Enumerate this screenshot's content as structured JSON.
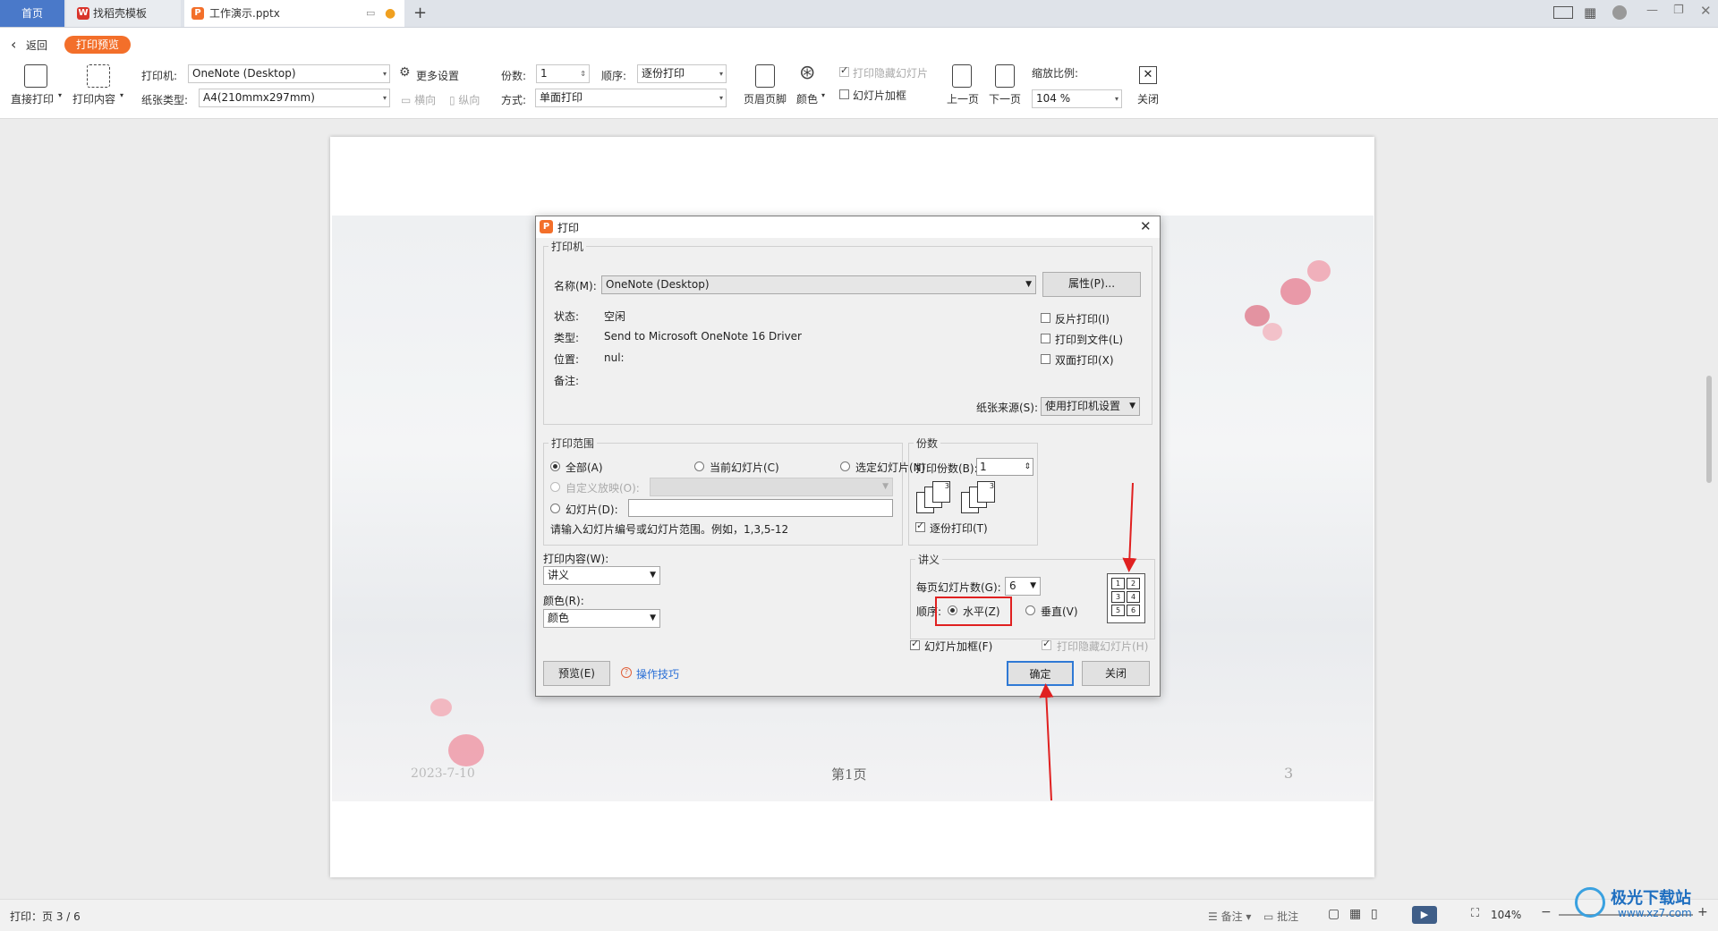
{
  "tabs": {
    "home": "首页",
    "template": "找稻壳模板",
    "file": "工作演示.pptx",
    "add": "+"
  },
  "toolbar": {
    "back": "返回",
    "badge": "打印预览",
    "direct_print": "直接打印",
    "print_content": "打印内容",
    "printer_label": "打印机:",
    "printer_value": "OneNote (Desktop)",
    "more_settings": "更多设置",
    "paper_label": "纸张类型:",
    "paper_value": "A4(210mmx297mm)",
    "landscape": "横向",
    "portrait": "纵向",
    "copies_label": "份数:",
    "copies_value": "1",
    "order_label": "顺序:",
    "order_value": "逐份打印",
    "mode_label": "方式:",
    "mode_value": "单面打印",
    "header_footer": "页眉页脚",
    "color": "颜色",
    "print_hidden": "打印隐藏幻灯片",
    "slide_frame": "幻灯片加框",
    "prev_page": "上一页",
    "next_page": "下一页",
    "zoom_label": "缩放比例:",
    "zoom_value": "104 %",
    "close": "关闭"
  },
  "slide": {
    "date": "2023-7-10",
    "page": "第1页",
    "number": "3"
  },
  "dialog": {
    "title": "打印",
    "printer_group": "打印机",
    "name_label": "名称(M):",
    "name_value": "OneNote (Desktop)",
    "properties_btn": "属性(P)...",
    "status_label": "状态:",
    "status_value": "空闲",
    "type_label": "类型:",
    "type_value": "Send to Microsoft OneNote 16 Driver",
    "location_label": "位置:",
    "location_value": "nul:",
    "comment_label": "备注:",
    "reverse_print": "反片打印(I)",
    "print_to_file": "打印到文件(L)",
    "duplex": "双面打印(X)",
    "paper_source_label": "纸张来源(S):",
    "paper_source_value": "使用打印机设置",
    "range_group": "打印范围",
    "all": "全部(A)",
    "current_slide": "当前幻灯片(C)",
    "selected_slide": "选定幻灯片(N)",
    "custom_show": "自定义放映(O):",
    "slides": "幻灯片(D):",
    "range_hint": "请输入幻灯片编号或幻灯片范围。例如，1,3,5-12",
    "copies_group": "份数",
    "copies_label": "打印份数(B):",
    "copies_value": "1",
    "collate": "逐份打印(T)",
    "content_label": "打印内容(W):",
    "content_value": "讲义",
    "color_label": "颜色(R):",
    "color_value": "颜色",
    "handout_group": "讲义",
    "per_page_label": "每页幻灯片数(G):",
    "per_page_value": "6",
    "order_label": "顺序:",
    "horizontal": "水平(Z)",
    "vertical": "垂直(V)",
    "frame_slides": "幻灯片加框(F)",
    "print_hidden": "打印隐藏幻灯片(H)",
    "preview_btn": "预览(E)",
    "tips_link": "操作技巧",
    "ok_btn": "确定",
    "close_btn": "关闭",
    "layout_numbers": [
      "1",
      "2",
      "3",
      "4",
      "5",
      "6"
    ]
  },
  "statusbar": {
    "print_page": "打印：页 3 / 6",
    "notes": "备注",
    "comments": "批注",
    "zoom": "104%"
  },
  "watermark": {
    "name": "极光下载站",
    "url": "www.xz7.com"
  },
  "colors": {
    "accent_orange": "#f36f2a",
    "tab_blue": "#4a79c9",
    "annotation_red": "#e02020",
    "link_blue": "#2a6fd6"
  }
}
